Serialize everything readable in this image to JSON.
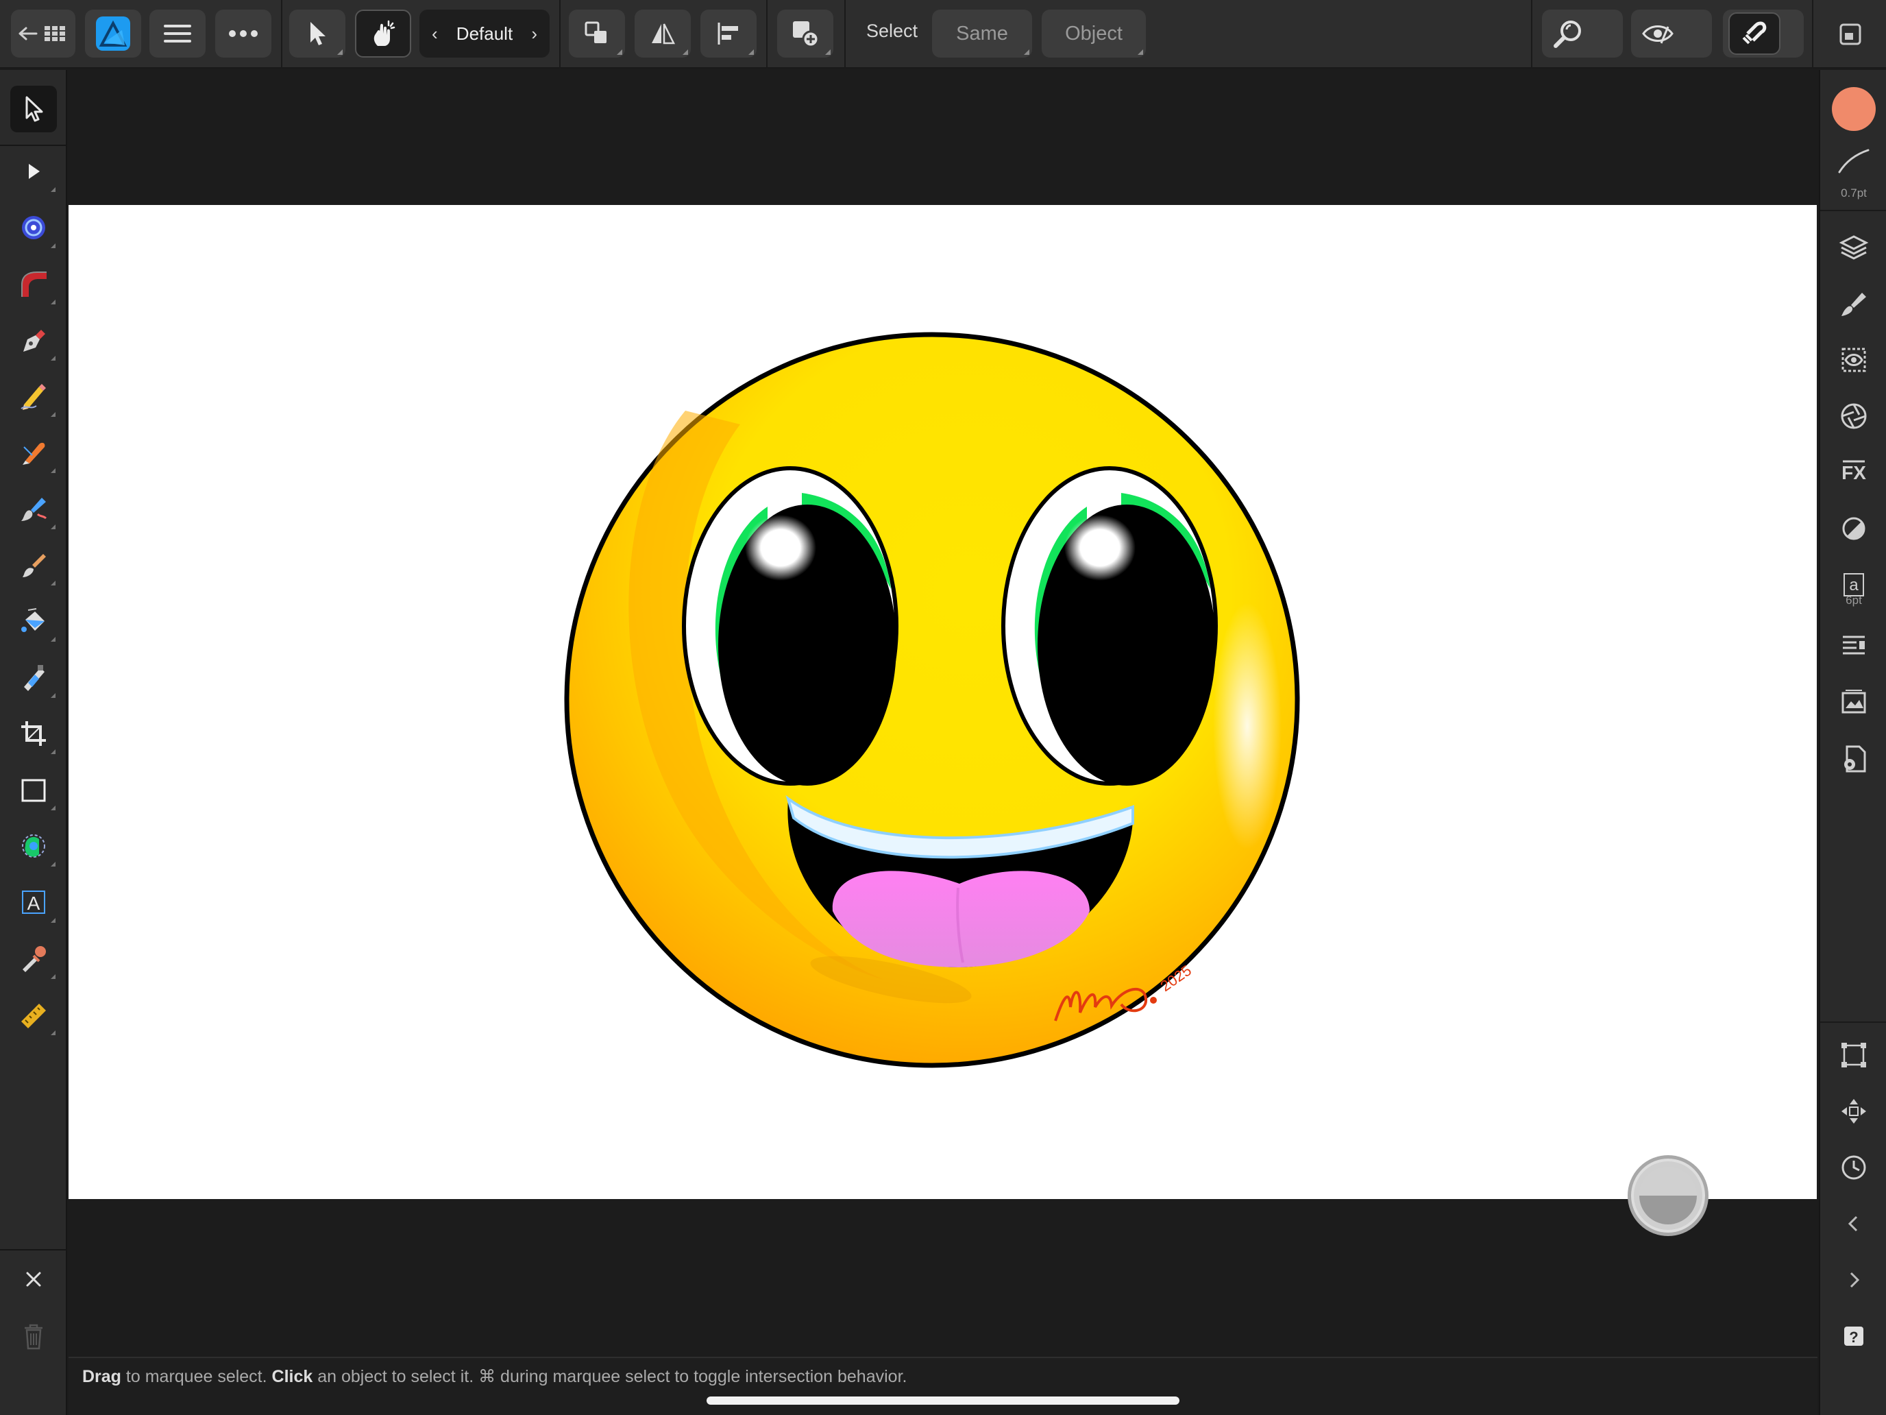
{
  "toolbar": {
    "persona_name": "Default",
    "select_label": "Select",
    "same_label": "Same",
    "object_label": "Object",
    "icons": [
      "back-grid-icon",
      "affinity-designer-logo",
      "menu-icon",
      "more-icon",
      "move-tool-icon",
      "touch-gesture-icon",
      "arrange-icon",
      "flip-icon",
      "align-icon",
      "boolean-add-icon",
      "zoom-icon",
      "view-mode-icon",
      "snapping-icon",
      "fullscreen-icon"
    ]
  },
  "left_tools": [
    {
      "name": "move-tool",
      "icon": "pointer-arrow-icon"
    },
    {
      "name": "node-tool",
      "icon": "node-arrow-icon"
    },
    {
      "name": "point-transform-tool",
      "icon": "target-icon"
    },
    {
      "name": "corner-tool",
      "icon": "corner-icon"
    },
    {
      "name": "pen-tool",
      "icon": "pen-nib-icon"
    },
    {
      "name": "pencil-tool",
      "icon": "pencil-icon"
    },
    {
      "name": "vector-brush-tool",
      "icon": "vector-brush-icon"
    },
    {
      "name": "paint-brush-tool",
      "icon": "paint-brush-icon"
    },
    {
      "name": "pixel-brush-tool",
      "icon": "pixel-brush-icon"
    },
    {
      "name": "fill-tool",
      "icon": "paint-bucket-icon"
    },
    {
      "name": "gradient-tool",
      "icon": "gradient-icon"
    },
    {
      "name": "crop-tool",
      "icon": "crop-icon"
    },
    {
      "name": "rectangle-tool",
      "icon": "rectangle-icon"
    },
    {
      "name": "shape-builder-tool",
      "icon": "shape-builder-icon"
    },
    {
      "name": "artistic-text-tool",
      "icon": "text-frame-icon"
    },
    {
      "name": "color-picker-tool",
      "icon": "eyedropper-icon"
    },
    {
      "name": "measure-tool",
      "icon": "ruler-icon"
    }
  ],
  "right_studio": {
    "stroke_width": "0.7pt",
    "text_size": "6pt",
    "fill_color": "#f08a6a",
    "icons": [
      "color-swatch",
      "stroke-icon",
      "layers-icon",
      "brushes-icon",
      "appearance-icon",
      "stock-icon",
      "fx-icon",
      "adjustments-icon",
      "text-styles-icon",
      "paragraph-icon",
      "assets-icon",
      "document-settings-icon",
      "transform-icon",
      "navigator-icon",
      "history-icon",
      "collapse-left-icon",
      "collapse-right-icon",
      "help-icon"
    ]
  },
  "canvas": {
    "artwork": "smiley-face",
    "signature_year": "2025",
    "signature_initials": "MO"
  },
  "status": {
    "drag_bold": "Drag",
    "drag_text": " to marquee select. ",
    "click_bold": "Click",
    "click_text": " an object to select it. ⌘ during marquee select to toggle intersection behavior."
  },
  "colors": {
    "toolbar_bg": "#2d2d2d",
    "panel_bg": "#2a2a2a",
    "canvas_bg": "#1c1c1c",
    "accent_blue": "#1d9bf0",
    "face_yellow": "#ffe600",
    "face_orange": "#ffb000",
    "eye_green": "#12e35a",
    "tongue_pink": "#f78cf2"
  }
}
